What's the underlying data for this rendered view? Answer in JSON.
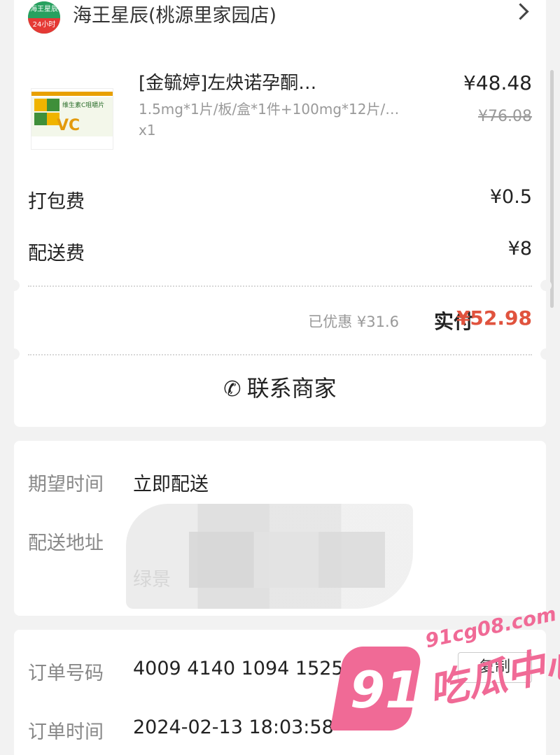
{
  "store": {
    "logo_top": "海王星辰",
    "logo_bottom": "24小时",
    "name": "海王星辰(桃源里家园店)"
  },
  "product": {
    "image_label": "维生素C咀嚼片",
    "image_mark": "VC",
    "name": "[金毓婷]左炔诺孕酮…",
    "spec": "1.5mg*1片/板/盒*1件+100mg*12片/…",
    "qty": "x1",
    "price": "¥48.48",
    "original_price": "¥76.08"
  },
  "fees": {
    "packing_label": "打包费",
    "packing_value": "¥0.5",
    "delivery_label": "配送费",
    "delivery_value": "¥8"
  },
  "summary": {
    "discount": "已优惠 ¥31.6",
    "paid_label": "实付",
    "paid_value": "¥52.98"
  },
  "contact": {
    "icon": "phone-icon",
    "label": "联系商家"
  },
  "delivery": {
    "time_label": "期望时间",
    "time_value": "立即配送",
    "address_label": "配送地址",
    "address_value": "绿景"
  },
  "order": {
    "number_label": "订单号码",
    "number_value": "4009 4140 1094 1525 23",
    "copy_label": "复制",
    "time_label": "订单时间",
    "time_value": "2024-02-13 18:03:58"
  },
  "watermark": {
    "number": "91",
    "text": "吃瓜中心",
    "url": "91cg08.com"
  },
  "colors": {
    "accent_red": "#e0533e",
    "watermark_pink": "#f06a96"
  }
}
